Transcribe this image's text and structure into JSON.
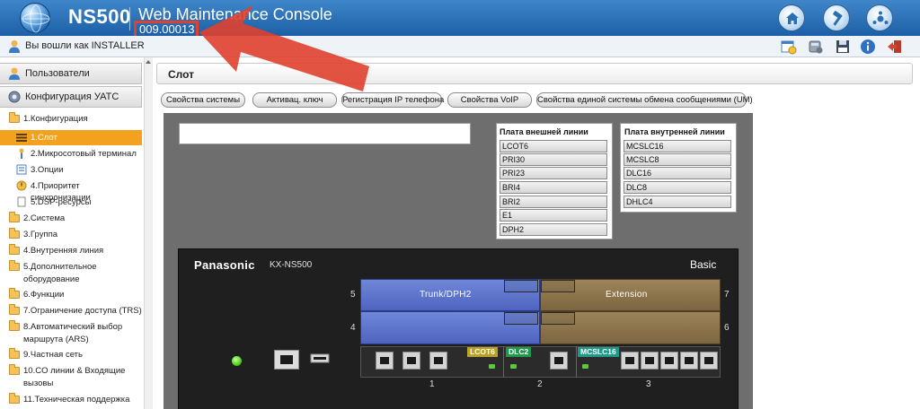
{
  "header": {
    "app_name": "NS500",
    "title": "Web Maintenance Console",
    "version": "009.00013"
  },
  "subheader": {
    "login": "Вы вошли как INSTALLER"
  },
  "sidebar": {
    "sections": [
      {
        "label": "Пользователи"
      },
      {
        "label": "Конфигурация УАТС"
      }
    ],
    "items": [
      {
        "label": "1.Конфигурация"
      },
      {
        "label": "1.Слот"
      },
      {
        "label": "2.Микросотовый терминал"
      },
      {
        "label": "3.Опции"
      },
      {
        "label": "4.Приоритет синхронизации"
      },
      {
        "label": "5.DSP-ресурсы"
      },
      {
        "label": "2.Система"
      },
      {
        "label": "3.Группа"
      },
      {
        "label": "4.Внутренняя линия"
      },
      {
        "label1": "5.Дополнительное",
        "label2": "оборудование"
      },
      {
        "label": "6.Функции"
      },
      {
        "label": "7.Ограничение доступа (TRS)"
      },
      {
        "label1": "8.Автоматический выбор",
        "label2": "маршрута (ARS)"
      },
      {
        "label": "9.Частная сеть"
      },
      {
        "label1": "10.CO линии & Входящие",
        "label2": "вызовы"
      },
      {
        "label": "11.Техническая поддержка"
      }
    ]
  },
  "main": {
    "page_title": "Слот",
    "buttons": [
      "Свойства системы",
      "Активац. ключ",
      "Регистрация IP телефона",
      "Свойства VoIP",
      "Свойства единой системы обмена сообщениями (UM)"
    ],
    "external_cards": {
      "title": "Плата внешней линии",
      "items": [
        "LCOT6",
        "PRI30",
        "PRI23",
        "BRI4",
        "BRI2",
        "E1",
        "DPH2"
      ]
    },
    "internal_cards": {
      "title": "Плата внутренней линии",
      "items": [
        "MCSLC16",
        "MCSLC8",
        "DLC16",
        "DLC8",
        "DHLC4"
      ]
    }
  },
  "device": {
    "brand": "Panasonic",
    "model": "KX-NS500",
    "edition": "Basic",
    "trunk_label": "Trunk/DPH2",
    "extension_label": "Extension",
    "slot_numbers": {
      "s5": "5",
      "s4": "4",
      "s7": "7",
      "s6": "6",
      "b1": "1",
      "b2": "2",
      "b3": "3"
    },
    "installed_cards": [
      {
        "name": "LCOT6",
        "color": "#b9a12a"
      },
      {
        "name": "DLC2",
        "color": "#1f9a4a"
      },
      {
        "name": "MCSLC16",
        "color": "#1e9a8a"
      }
    ]
  },
  "colors": {
    "header": "#2a6fb5",
    "selected_item": "#f2a21f",
    "annotation": "#e0402e",
    "trunk": "#5b72cc",
    "extension": "#8c744c"
  }
}
